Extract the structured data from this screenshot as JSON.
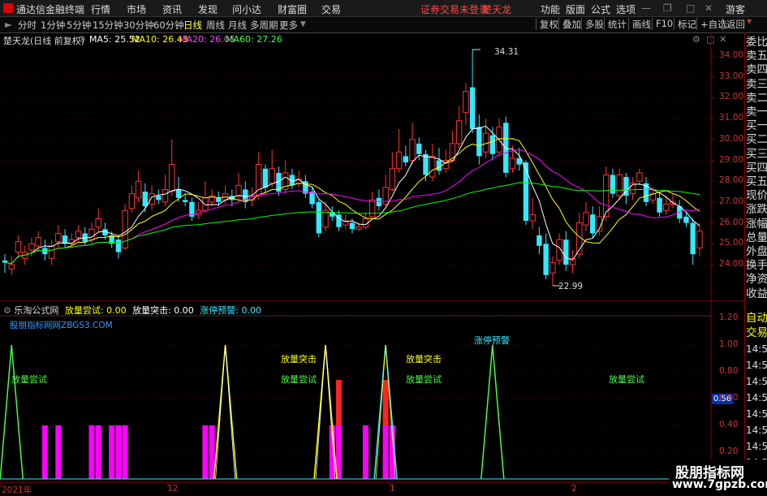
{
  "titlebar": {
    "app_title": "通达信金融终端",
    "menus": [
      "行情",
      "市场",
      "资讯",
      "发现",
      "问小达",
      "财富圈",
      "交易"
    ],
    "status_text": "证券交易未登录",
    "stock_name": "楚天龙",
    "right_menus": [
      "功能",
      "版面",
      "公式",
      "选项"
    ],
    "guest": "游客"
  },
  "toolbar": {
    "periods": [
      "分时",
      "1分钟",
      "5分钟",
      "15分钟",
      "30分钟",
      "60分钟",
      "日线",
      "周线",
      "月线",
      "多周期",
      "更多"
    ],
    "active_period": "日线",
    "right_buttons": [
      "复权",
      "叠加",
      "多股",
      "统计",
      "画线",
      "F10",
      "标记",
      "+自选",
      "返回"
    ]
  },
  "main_chart": {
    "title": "楚天龙(日线 前复权)",
    "ma_labels": [
      {
        "text": "MA5: 25.52",
        "color": "#ffffff"
      },
      {
        "text": "MA10: 26.43",
        "color": "#ffff00"
      },
      {
        "text": "MA20: 26.05",
        "color": "#ff44ff"
      },
      {
        "text": "MA60: 27.26",
        "color": "#44ff44"
      }
    ],
    "high_label": "34.31",
    "low_label": "22.99",
    "y_ticks": [
      "34.00",
      "33.00",
      "32.00",
      "31.00",
      "30.00",
      "29.00",
      "28.00",
      "27.00",
      "26.00",
      "25.00",
      "24.00"
    ],
    "colors": {
      "up": "#ff3333",
      "down": "#33e8ff",
      "ma5": "#ffffff",
      "ma10": "#ffff00",
      "ma20": "#ff00ff",
      "ma60": "#00ff00"
    }
  },
  "indicator": {
    "title": "乐淘公式网",
    "values": [
      {
        "text": "放量尝试: 0.00",
        "color": "#ffff00"
      },
      {
        "text": "放量突击: 0.00",
        "color": "#ffffff"
      },
      {
        "text": "涨停预警: 0.00",
        "color": "#33e8ff"
      }
    ],
    "source": "股朋指标网网ZBGS3.COM",
    "y_ticks": [
      "1.20",
      "1.00",
      "0.80",
      "0.60",
      "0.40",
      "0.20"
    ],
    "current_value": "0.56",
    "labels": [
      {
        "text": "放量尝试",
        "color": "#44ff44"
      },
      {
        "text": "放量突击",
        "color": "#ffff00"
      },
      {
        "text": "放量尝试",
        "color": "#44ff44"
      },
      {
        "text": "放量突击",
        "color": "#ffff00"
      },
      {
        "text": "放量尝试",
        "color": "#44ff44"
      },
      {
        "text": "涨停预警",
        "color": "#33e8ff"
      },
      {
        "text": "放量尝试",
        "color": "#44ff44"
      }
    ]
  },
  "x_axis": {
    "labels": [
      "2021年",
      "12",
      "1",
      "2"
    ]
  },
  "right_panel": {
    "items": [
      "委比",
      "卖五",
      "卖四",
      "卖三",
      "卖二",
      "卖一",
      "买一",
      "买二",
      "买三",
      "买四",
      "买五",
      "现价",
      "涨跌",
      "涨幅",
      "总量",
      "外盘",
      "换手",
      "净资",
      "收益"
    ],
    "bottom_items": [
      "自动",
      "交易"
    ],
    "times": [
      "14:56",
      "14:56",
      "14:56",
      "14:56",
      "14:56",
      "14:56",
      "14:56",
      "14:56",
      "14:56"
    ]
  },
  "watermark": {
    "line1": "股朋指标网",
    "line2": "www.7gpzb.com"
  },
  "chart_data": {
    "type": "candlestick",
    "title": "楚天龙(日线 前复权)",
    "ylim": [
      23.0,
      34.6
    ],
    "candles": [
      [
        24.2,
        24.1,
        24.5,
        23.6
      ],
      [
        23.8,
        24.0,
        24.4,
        23.5
      ],
      [
        24.6,
        25.1,
        25.4,
        24.3
      ],
      [
        24.3,
        24.6,
        24.9,
        24.0
      ],
      [
        24.7,
        25.0,
        25.3,
        24.4
      ],
      [
        24.9,
        25.3,
        25.6,
        24.6
      ],
      [
        24.8,
        24.5,
        25.2,
        24.2
      ],
      [
        24.3,
        24.9,
        25.2,
        24.0
      ],
      [
        25.1,
        25.5,
        25.9,
        24.8
      ],
      [
        25.4,
        25.0,
        25.7,
        24.8
      ],
      [
        25.0,
        25.2,
        25.5,
        24.8
      ],
      [
        25.3,
        25.6,
        25.9,
        25.1
      ],
      [
        25.5,
        25.1,
        25.8,
        24.9
      ],
      [
        25.2,
        25.7,
        26.0,
        25.0
      ],
      [
        25.8,
        26.2,
        26.7,
        25.6
      ],
      [
        25.7,
        25.4,
        26.0,
        25.2
      ],
      [
        25.4,
        25.0,
        25.6,
        24.8
      ],
      [
        25.2,
        24.6,
        25.4,
        24.3
      ],
      [
        24.8,
        26.6,
        26.9,
        24.7
      ],
      [
        26.7,
        27.4,
        27.8,
        26.5
      ],
      [
        27.2,
        28.0,
        28.5,
        27.0
      ],
      [
        27.5,
        26.8,
        27.9,
        26.5
      ],
      [
        26.9,
        27.4,
        27.8,
        26.6
      ],
      [
        27.3,
        27.1,
        27.6,
        26.9
      ],
      [
        27.0,
        27.6,
        28.3,
        26.8
      ],
      [
        27.5,
        28.8,
        30.0,
        27.3
      ],
      [
        27.6,
        27.2,
        28.2,
        27.0
      ],
      [
        27.1,
        27.0,
        27.4,
        26.8
      ],
      [
        27.0,
        26.3,
        27.2,
        26.1
      ],
      [
        26.4,
        26.6,
        27.0,
        26.2
      ],
      [
        26.6,
        27.2,
        28.0,
        26.5
      ],
      [
        27.0,
        27.3,
        27.6,
        26.8
      ],
      [
        27.2,
        27.0,
        27.5,
        26.8
      ],
      [
        27.1,
        27.4,
        27.8,
        26.9
      ],
      [
        27.3,
        27.1,
        27.6,
        26.8
      ],
      [
        27.3,
        27.8,
        28.4,
        27.1
      ],
      [
        27.6,
        27.0,
        28.0,
        26.7
      ],
      [
        27.1,
        27.3,
        27.7,
        26.8
      ],
      [
        27.3,
        28.8,
        29.4,
        27.1
      ],
      [
        28.6,
        27.7,
        28.8,
        27.4
      ],
      [
        27.9,
        28.6,
        29.5,
        27.7
      ],
      [
        28.4,
        27.5,
        28.7,
        27.3
      ],
      [
        27.6,
        28.4,
        29.0,
        27.4
      ],
      [
        28.3,
        27.8,
        28.6,
        27.6
      ],
      [
        27.9,
        28.1,
        28.5,
        27.7
      ],
      [
        28.0,
        27.4,
        28.3,
        27.2
      ],
      [
        27.5,
        26.9,
        27.7,
        26.7
      ],
      [
        27.0,
        25.5,
        27.1,
        25.3
      ],
      [
        25.8,
        26.6,
        27.0,
        25.6
      ],
      [
        26.5,
        26.3,
        26.8,
        26.1
      ],
      [
        26.4,
        25.8,
        26.6,
        25.6
      ],
      [
        25.9,
        26.1,
        26.4,
        25.7
      ],
      [
        26.0,
        25.7,
        26.2,
        25.5
      ],
      [
        25.7,
        25.8,
        26.0,
        25.6
      ],
      [
        25.8,
        26.2,
        26.5,
        25.7
      ],
      [
        26.3,
        27.1,
        27.5,
        26.2
      ],
      [
        27.2,
        26.8,
        27.6,
        26.6
      ],
      [
        26.9,
        27.7,
        28.3,
        26.8
      ],
      [
        27.6,
        28.6,
        29.4,
        27.5
      ],
      [
        28.6,
        29.4,
        30.5,
        28.4
      ],
      [
        29.2,
        28.9,
        29.7,
        28.7
      ],
      [
        29.0,
        30.0,
        30.8,
        28.8
      ],
      [
        29.8,
        29.3,
        30.1,
        29.0
      ],
      [
        29.3,
        28.3,
        29.5,
        28.0
      ],
      [
        28.2,
        29.2,
        29.8,
        28.0
      ],
      [
        29.0,
        28.5,
        29.6,
        28.3
      ],
      [
        28.6,
        29.0,
        29.5,
        28.4
      ],
      [
        29.0,
        29.8,
        30.4,
        28.9
      ],
      [
        29.8,
        30.9,
        31.6,
        29.6
      ],
      [
        31.3,
        32.3,
        32.7,
        30.7
      ],
      [
        32.5,
        30.5,
        34.31,
        30.3
      ],
      [
        30.6,
        29.2,
        31.2,
        28.8
      ],
      [
        29.4,
        30.3,
        31.0,
        29.1
      ],
      [
        30.2,
        29.3,
        30.6,
        29.0
      ],
      [
        29.4,
        30.6,
        31.0,
        29.2
      ],
      [
        30.8,
        28.4,
        31.1,
        28.2
      ],
      [
        28.6,
        29.1,
        29.7,
        28.4
      ],
      [
        29.1,
        28.8,
        29.6,
        28.5
      ],
      [
        28.9,
        26.1,
        29.0,
        25.9
      ],
      [
        26.1,
        26.4,
        27.2,
        25.7
      ],
      [
        25.4,
        24.9,
        25.8,
        24.5
      ],
      [
        25.0,
        23.5,
        25.5,
        23.3
      ],
      [
        23.6,
        24.1,
        24.4,
        22.99
      ],
      [
        24.2,
        25.2,
        25.5,
        24.0
      ],
      [
        25.2,
        24.0,
        25.6,
        23.7
      ],
      [
        24.0,
        24.3,
        24.7,
        23.6
      ],
      [
        24.5,
        26.0,
        26.5,
        24.3
      ],
      [
        25.9,
        26.5,
        27.0,
        25.6
      ],
      [
        26.4,
        25.5,
        26.8,
        25.3
      ],
      [
        25.6,
        26.3,
        26.8,
        25.4
      ],
      [
        26.3,
        28.3,
        28.7,
        26.1
      ],
      [
        28.3,
        27.4,
        28.6,
        27.2
      ],
      [
        27.3,
        28.3,
        28.6,
        27.1
      ],
      [
        28.2,
        27.3,
        28.4,
        26.9
      ],
      [
        27.4,
        27.9,
        28.2,
        27.1
      ],
      [
        28.0,
        28.4,
        28.6,
        27.8
      ],
      [
        27.9,
        27.0,
        28.2,
        26.8
      ],
      [
        27.1,
        27.4,
        27.7,
        26.9
      ],
      [
        27.2,
        26.5,
        27.5,
        26.3
      ],
      [
        26.6,
        26.9,
        27.3,
        26.4
      ],
      [
        26.9,
        27.0,
        27.4,
        26.7
      ],
      [
        26.8,
        26.2,
        27.1,
        26.0
      ],
      [
        26.3,
        26.0,
        26.5,
        25.8
      ],
      [
        26.0,
        24.5,
        26.2,
        24.0
      ],
      [
        24.8,
        25.6,
        26.0,
        24.4
      ]
    ],
    "indicator_signals": [
      {
        "x_index": 1,
        "series": "放量尝试",
        "value": 1.0
      },
      {
        "x_index": 33,
        "series": "放量突击",
        "value": 1.0
      },
      {
        "x_index": 48,
        "series": "放量突击",
        "value": 1.0
      },
      {
        "x_index": 57,
        "series": "涨停预警",
        "value": 1.0
      },
      {
        "x_index": 73,
        "series": "放量尝试",
        "value": 1.0
      }
    ],
    "indicator_bars_magenta": [
      6,
      8,
      13,
      14,
      16,
      17,
      18,
      30,
      31,
      49,
      50,
      54,
      57,
      58
    ],
    "indicator_bars_red": [
      50,
      57
    ]
  }
}
